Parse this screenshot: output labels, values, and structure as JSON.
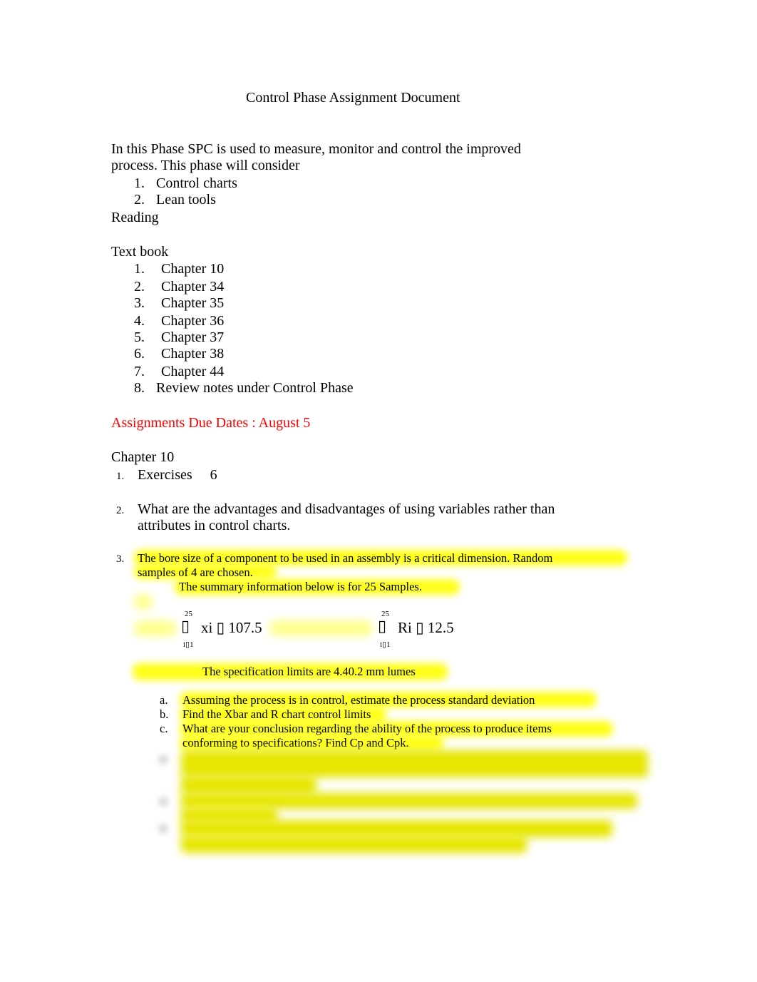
{
  "document": {
    "title": "Control Phase Assignment Document",
    "intro_line1": "In this Phase SPC is used to measure, monitor and control the improved",
    "intro_line2": "process. This phase will consider",
    "topics": [
      {
        "num": "1.",
        "label": "Control charts"
      },
      {
        "num": "2.",
        "label": "Lean tools"
      }
    ],
    "reading_label": "Reading",
    "textbook_label": "Text book",
    "chapters": [
      {
        "num": "1.",
        "label": "Chapter 10"
      },
      {
        "num": "2.",
        "label": "Chapter 34"
      },
      {
        "num": "3.",
        "label": "Chapter 35"
      },
      {
        "num": "4.",
        "label": "Chapter 36"
      },
      {
        "num": "5.",
        "label": "Chapter 37"
      },
      {
        "num": "6.",
        "label": "Chapter 38"
      },
      {
        "num": "7.",
        "label": "Chapter 44"
      },
      {
        "num": "8.",
        "label": "Review notes under Control Phase"
      }
    ],
    "due_dates": "Assignments Due Dates : August 5",
    "due_color": "#ff0000",
    "highlight_color": "#ffff00",
    "chapter_heading": "Chapter 10",
    "questions": [
      {
        "num": "1.",
        "text": "Exercises     6"
      },
      {
        "num": "2.",
        "line1": "What are the advantages and disadvantages of using variables rather than",
        "line2": "attributes in control charts."
      },
      {
        "num": "3.",
        "line1": "The bore size of a component to be used in an assembly is a critical dimension. Random",
        "line2": "samples of 4 are chosen.",
        "line3": "The summary information below is for 25 Samples."
      }
    ],
    "formula": {
      "sum1": {
        "upper": "25",
        "lower": "i▯1",
        "sigma": "▯",
        "expr": "xi ▯ 107.5"
      },
      "sum2": {
        "upper": "25",
        "lower": "i▯1",
        "sigma": "▯",
        "expr": "Ri ▯ 12.5"
      }
    },
    "spec_limits": "The specification limits are 4.40.2 mm lumes",
    "subquestions": [
      {
        "letter": "a.",
        "text": "Assuming the process is in control, estimate the process standard deviation"
      },
      {
        "letter": "b.",
        "text": "Find the Xbar and R chart control limits"
      },
      {
        "letter": "c.",
        "line1": "What are your conclusion regarding the ability of the process to produce items",
        "line2": "conforming to specifications? Find Cp and Cpk."
      }
    ]
  }
}
